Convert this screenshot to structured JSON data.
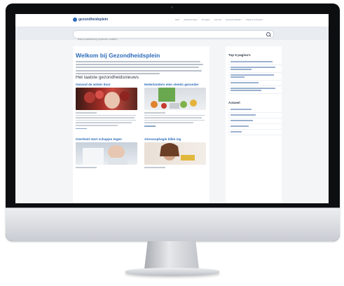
{
  "site": {
    "logo": "gezondheidsplein",
    "nav": [
      "Start",
      "Aandoeningen",
      "Therapie",
      "Gezond",
      "Geneesmiddelen",
      "Vraag & Antwoord"
    ],
    "search_placeholder": "Zoek op aandoening, symptoom, medicijn..."
  },
  "main": {
    "title": "Welkom bij Gezondheidsplein",
    "section_title": "Het laatste gezondheidsnieuws",
    "articles": [
      {
        "title": "Gezond de winter door"
      },
      {
        "title": "Nederlanders eten steeds gezonder"
      },
      {
        "title": "Overheid stort schapjes tegen"
      },
      {
        "title": "Atrosoophagie blikk ing"
      }
    ]
  },
  "sidebar": {
    "top_title": "Top 5 pagina's",
    "top_count": 5,
    "list_title": "Actueel",
    "list_count": 5
  },
  "colors": {
    "accent": "#2b6bb8",
    "bezel": "#0d0e10",
    "stand": "#c9ccd2"
  }
}
